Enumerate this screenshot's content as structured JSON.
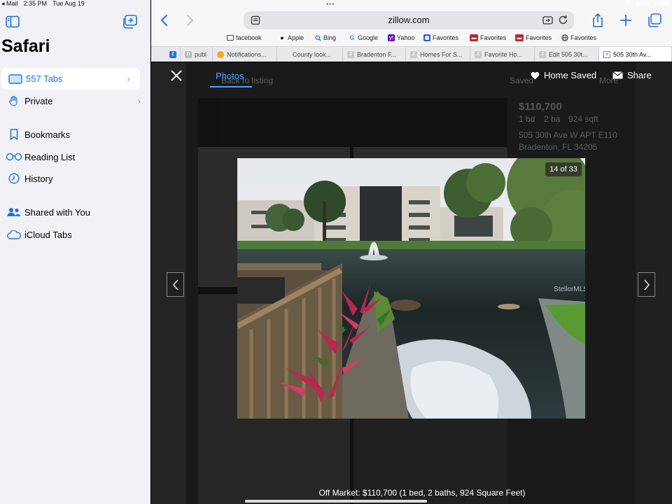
{
  "status_bar": {
    "back_app": "◂ Mail",
    "time": "2:35 PM",
    "date": "Tue Aug 19",
    "battery_text": "100%"
  },
  "sidebar": {
    "title": "Safari",
    "items": [
      {
        "label": "557 Tabs",
        "icon": "tabs-icon"
      },
      {
        "label": "Private",
        "icon": "hand-icon"
      },
      {
        "label": "Bookmarks",
        "icon": "bookmark-icon"
      },
      {
        "label": "Reading List",
        "icon": "glasses-icon"
      },
      {
        "label": "History",
        "icon": "clock-icon"
      },
      {
        "label": "Shared with You",
        "icon": "people-icon"
      },
      {
        "label": "iCloud Tabs",
        "icon": "cloud-icon"
      }
    ]
  },
  "toolbar": {
    "url": "zillow.com"
  },
  "favorites": [
    {
      "label": "facebook",
      "icon": "folder-icon"
    },
    {
      "label": "Apple",
      "icon": "apple-icon"
    },
    {
      "label": "Bing",
      "icon": "search-icon"
    },
    {
      "label": "Google",
      "icon": "google-icon"
    },
    {
      "label": "Yahoo",
      "icon": "yahoo-icon"
    },
    {
      "label": "Favorites",
      "icon": "grid-icon"
    },
    {
      "label": "Favorites",
      "icon": "car-icon"
    },
    {
      "label": "Favorites",
      "icon": "car-icon"
    },
    {
      "label": "Favorites",
      "icon": "globe-icon"
    }
  ],
  "tabs": [
    {
      "label": "Z"
    },
    {
      "label": "publ"
    },
    {
      "label": "Notifications..."
    },
    {
      "label": "County look..."
    },
    {
      "label": "Bradenton F..."
    },
    {
      "label": "Homes For S..."
    },
    {
      "label": "Favorite Ho..."
    },
    {
      "label": "Edit 505 30t..."
    },
    {
      "label": "505 30th Av..."
    }
  ],
  "background_page": {
    "price": "$110,700",
    "beds": "1 bd",
    "baths": "2 ba",
    "sqft": "924 sqft",
    "address1": "505 30th Ave W APT E110",
    "address2": "Bradenton, FL 34205",
    "back_link": "Back to listing",
    "saved": "Saved",
    "more": "More"
  },
  "lightbox": {
    "photos_tab": "Photos",
    "home_saved": "Home Saved",
    "share": "Share",
    "counter": "14 of 33",
    "watermark": "StellorMLS",
    "caption": "Off Market: $110,700 (1 bed, 2 baths, 924 Square Feet)"
  }
}
